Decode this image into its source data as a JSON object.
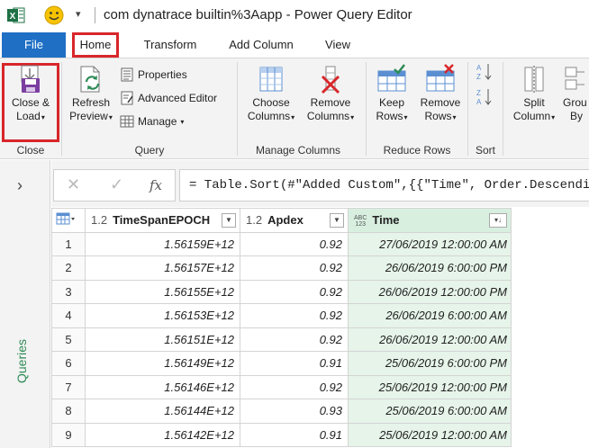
{
  "window": {
    "title": "com dynatrace builtin%3Aapp - Power Query Editor"
  },
  "tabs": {
    "file": "File",
    "home": "Home",
    "transform": "Transform",
    "add_column": "Add Column",
    "view": "View"
  },
  "ribbon": {
    "close_group": {
      "label": "Close",
      "close_load_line1": "Close &",
      "close_load_line2": "Load"
    },
    "query_group": {
      "label": "Query",
      "refresh_line1": "Refresh",
      "refresh_line2": "Preview",
      "properties": "Properties",
      "advanced_editor": "Advanced Editor",
      "manage": "Manage"
    },
    "manage_columns_group": {
      "label": "Manage Columns",
      "choose_line1": "Choose",
      "choose_line2": "Columns",
      "remove_line1": "Remove",
      "remove_line2": "Columns"
    },
    "reduce_rows_group": {
      "label": "Reduce Rows",
      "keep_line1": "Keep",
      "keep_line2": "Rows",
      "remove_line1": "Remove",
      "remove_line2": "Rows"
    },
    "sort_group": {
      "label": "Sort"
    },
    "transform_group": {
      "split_line1": "Split",
      "split_line2": "Column",
      "group_line1": "Grou",
      "group_line2": "By"
    }
  },
  "sidebar": {
    "label": "Queries"
  },
  "formula_bar": {
    "fx": "fx",
    "formula": "= Table.Sort(#\"Added Custom\",{{\"Time\", Order.Descending}})"
  },
  "grid": {
    "columns": [
      {
        "type": "1.2",
        "name": "TimeSpanEPOCH"
      },
      {
        "type": "1.2",
        "name": "Apdex"
      },
      {
        "type_line1": "ABC",
        "type_line2": "123",
        "name": "Time"
      }
    ],
    "rows": [
      {
        "n": "1",
        "epoch": "1.56159E+12",
        "apdex": "0.92",
        "time": "27/06/2019 12:00:00 AM"
      },
      {
        "n": "2",
        "epoch": "1.56157E+12",
        "apdex": "0.92",
        "time": "26/06/2019 6:00:00 PM"
      },
      {
        "n": "3",
        "epoch": "1.56155E+12",
        "apdex": "0.92",
        "time": "26/06/2019 12:00:00 PM"
      },
      {
        "n": "4",
        "epoch": "1.56153E+12",
        "apdex": "0.92",
        "time": "26/06/2019 6:00:00 AM"
      },
      {
        "n": "5",
        "epoch": "1.56151E+12",
        "apdex": "0.92",
        "time": "26/06/2019 12:00:00 AM"
      },
      {
        "n": "6",
        "epoch": "1.56149E+12",
        "apdex": "0.91",
        "time": "25/06/2019 6:00:00 PM"
      },
      {
        "n": "7",
        "epoch": "1.56146E+12",
        "apdex": "0.92",
        "time": "25/06/2019 12:00:00 PM"
      },
      {
        "n": "8",
        "epoch": "1.56144E+12",
        "apdex": "0.93",
        "time": "25/06/2019 6:00:00 AM"
      },
      {
        "n": "9",
        "epoch": "1.56142E+12",
        "apdex": "0.91",
        "time": "25/06/2019 12:00:00 AM"
      }
    ]
  },
  "colors": {
    "file_tab": "#1f6fc5",
    "highlight": "#d8262a",
    "time_column": "#e6f4ea",
    "queries_label": "#2e8b57"
  }
}
